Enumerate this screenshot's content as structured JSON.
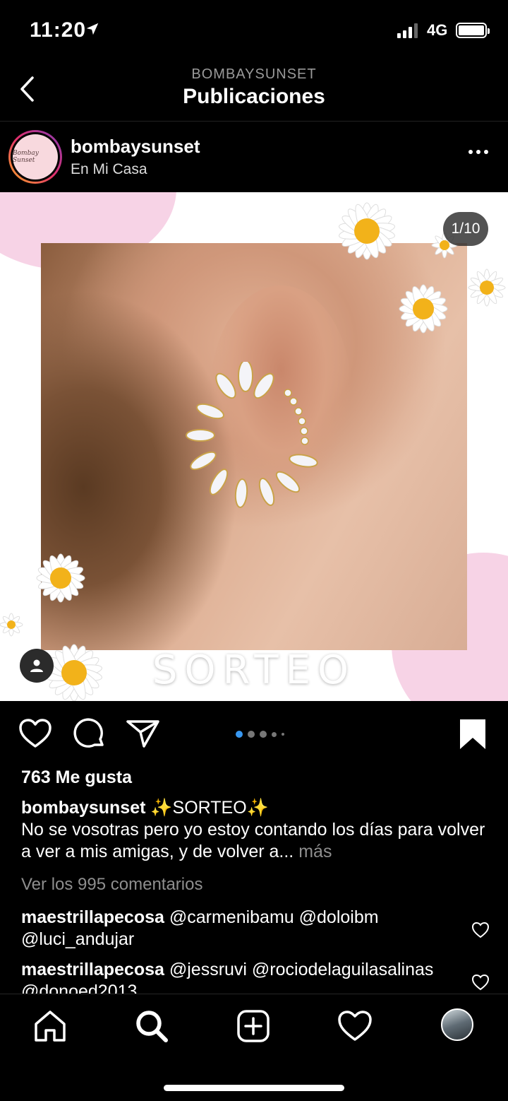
{
  "status_bar": {
    "time": "11:20",
    "network": "4G",
    "icons": [
      "location-arrow-icon",
      "signal-icon",
      "battery-icon"
    ]
  },
  "nav": {
    "account": "BOMBAYSUNSET",
    "title": "Publicaciones",
    "back_icon": "chevron-left-icon"
  },
  "post": {
    "username": "bombaysunset",
    "location": "En Mi Casa",
    "avatar_text": "Bombay Sunset",
    "image_counter": "1/10",
    "image_text": "SORTEO",
    "likes": "763 Me gusta",
    "caption_user": "bombaysunset",
    "caption_title": "✨SORTEO✨",
    "caption_text": "No se vosotras pero yo estoy contando los días para volver a ver a mis amigas, y de volver a...",
    "caption_more": "más",
    "view_comments": "Ver los 995 comentarios",
    "comments": [
      {
        "user": "maestrillapecosa",
        "text": "@carmenibamu @doloibm @luci_andujar"
      },
      {
        "user": "maestrillapecosa",
        "text": "@jessruvi @rociodelaguilasalinas @donoed2013"
      }
    ],
    "carousel_dots": 5,
    "carousel_active": 1
  },
  "tabbar": {
    "items": [
      "home-icon",
      "search-icon",
      "add-post-icon",
      "activity-heart-icon",
      "profile-avatar"
    ]
  },
  "colors": {
    "background": "#000000",
    "accent_blue": "#3897f0",
    "muted": "#8e8e8e",
    "pink": "#f7d3e6"
  }
}
